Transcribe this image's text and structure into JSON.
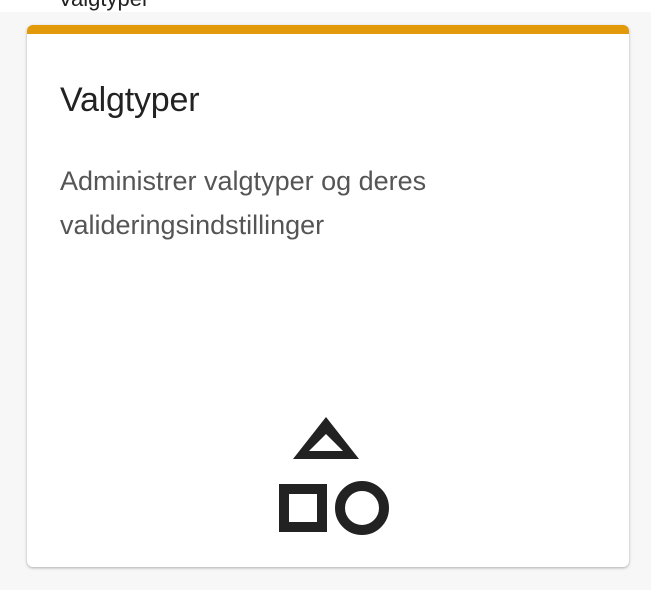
{
  "card": {
    "title": "Valgtyper",
    "description": "Administrer valgtyper og deres valideringsindstillinger",
    "accent_color": "#e39a0a",
    "icon": "shapes-icon"
  },
  "page": {
    "background": "#f7f7f7",
    "top_fragment_text": "Valgtyper"
  }
}
